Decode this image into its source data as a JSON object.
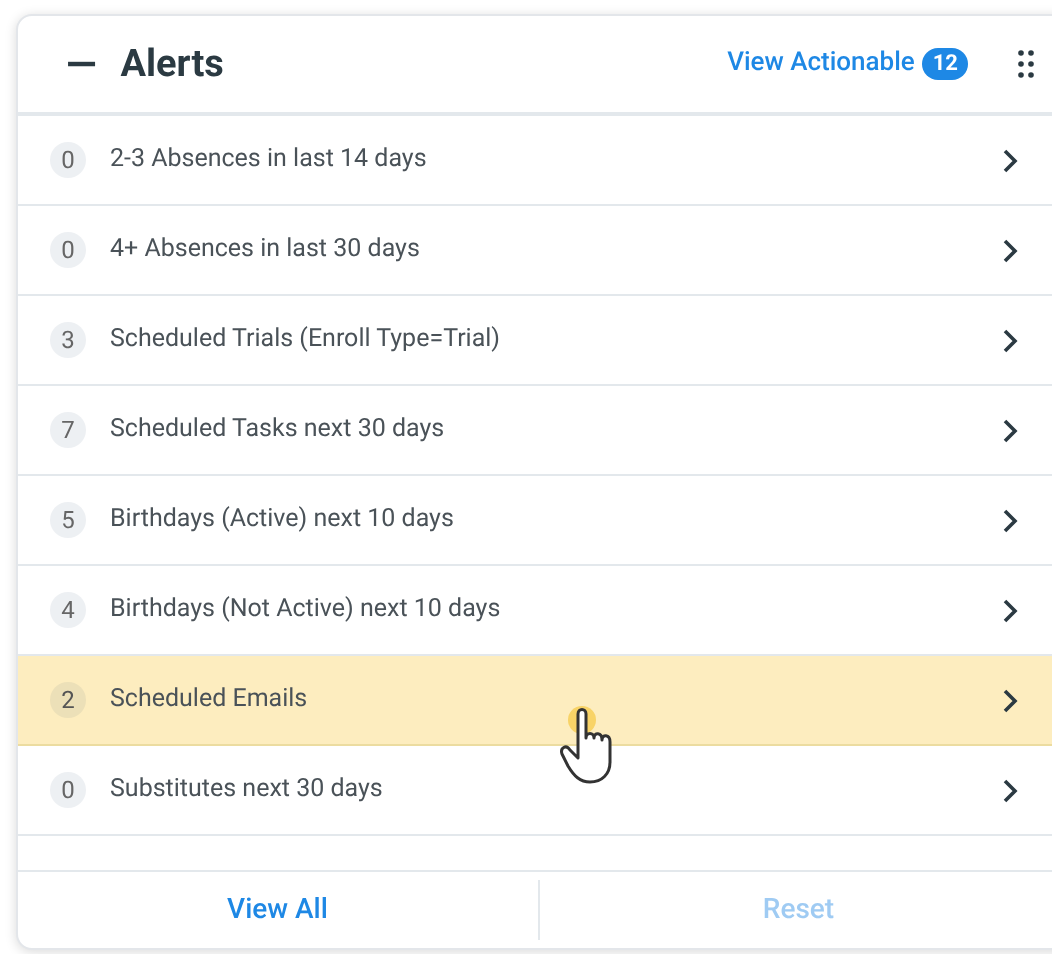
{
  "header": {
    "collapse_icon": "—",
    "title": "Alerts",
    "view_actionable": "View Actionable",
    "actionable_count": "12"
  },
  "alerts": [
    {
      "count": "0",
      "label": "2-3 Absences in last 14 days",
      "selected": false
    },
    {
      "count": "0",
      "label": "4+ Absences in last 30 days",
      "selected": false
    },
    {
      "count": "3",
      "label": "Scheduled Trials (Enroll Type=Trial)",
      "selected": false
    },
    {
      "count": "7",
      "label": "Scheduled Tasks next 30 days",
      "selected": false
    },
    {
      "count": "5",
      "label": "Birthdays (Active) next 10 days",
      "selected": false
    },
    {
      "count": "4",
      "label": "Birthdays (Not Active) next 10 days",
      "selected": false
    },
    {
      "count": "2",
      "label": "Scheduled Emails",
      "selected": true
    },
    {
      "count": "0",
      "label": "Substitutes next 30 days",
      "selected": false
    }
  ],
  "footer": {
    "view_all": {
      "label": "View All",
      "disabled": false
    },
    "reset": {
      "label": "Reset",
      "disabled": true
    }
  }
}
